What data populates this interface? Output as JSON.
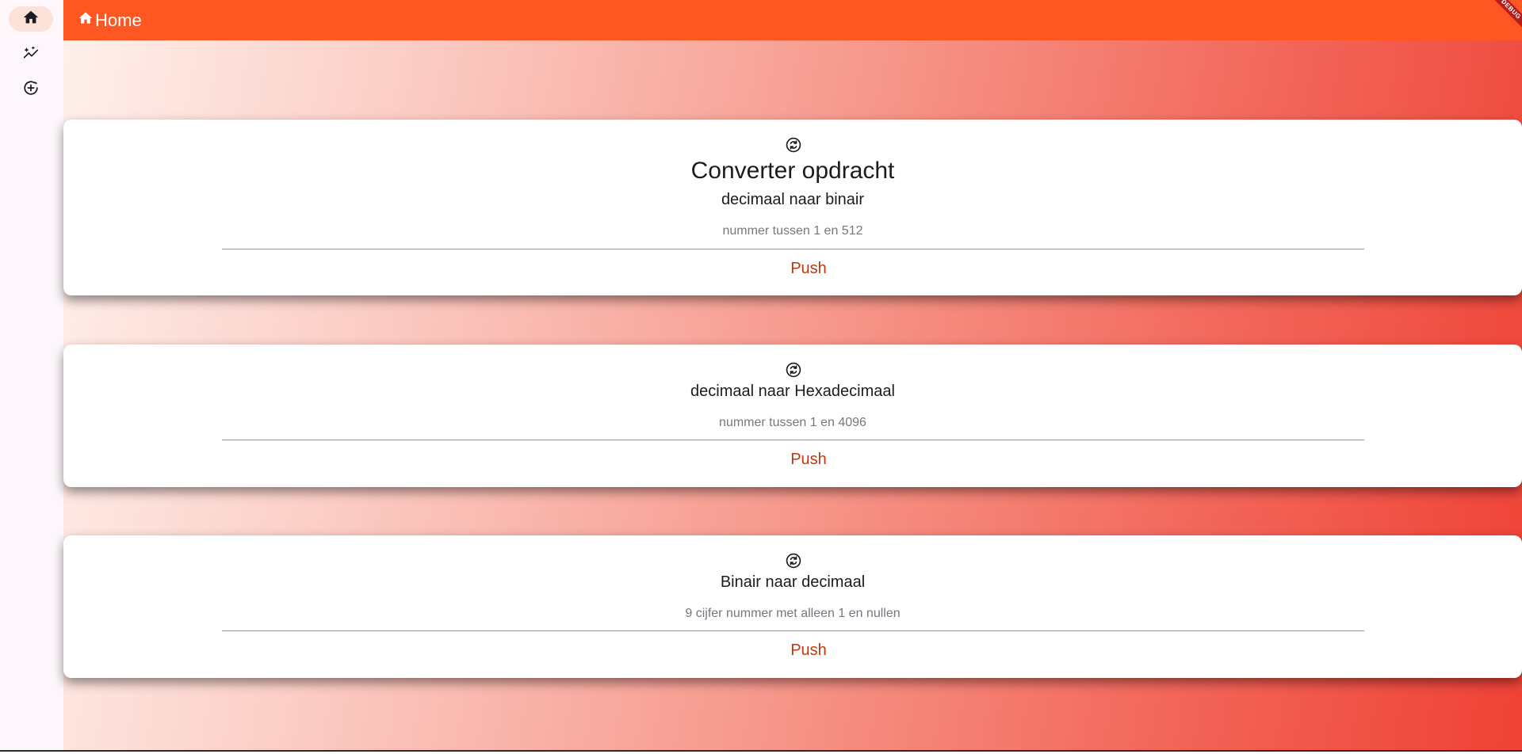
{
  "nav": {
    "items": [
      {
        "icon": "home-icon",
        "active": true
      },
      {
        "icon": "auto-graph-icon",
        "active": false
      },
      {
        "icon": "add-circle-icon",
        "active": false
      }
    ]
  },
  "appbar": {
    "title": "Home",
    "debug_label": "DEBUG",
    "color": "#ff5722"
  },
  "cards": [
    {
      "icon": "sync-icon",
      "heading": "Converter opdracht",
      "subheading": "decimaal naar binair",
      "placeholder": "nummer tussen 1 en 512",
      "button": "Push"
    },
    {
      "icon": "sync-icon",
      "heading": "",
      "subheading": "decimaal naar Hexadecimaal",
      "placeholder": "nummer tussen 1 en 4096",
      "button": "Push"
    },
    {
      "icon": "sync-icon",
      "heading": "",
      "subheading": "Binair naar decimaal",
      "placeholder": "9 cijfer nummer met alleen 1 en nullen",
      "button": "Push"
    }
  ],
  "colors": {
    "accent": "#bf360c",
    "appbar": "#ff5722",
    "gradient_start": "#fff0ec",
    "gradient_end": "#ef4135"
  }
}
